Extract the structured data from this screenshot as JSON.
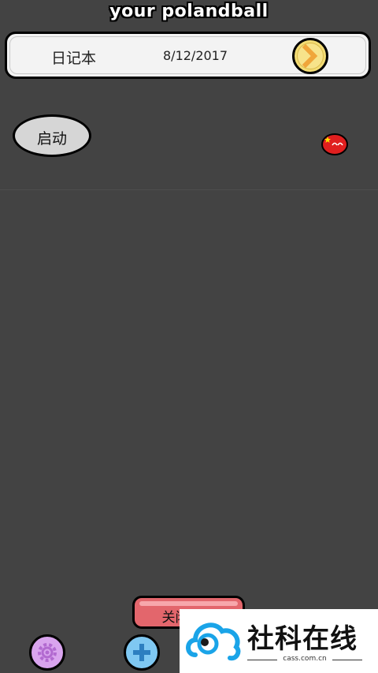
{
  "app": {
    "title": "your polandball"
  },
  "header": {
    "diary_label": "日记本",
    "date": "8/12/2017"
  },
  "main": {
    "start_label": "启动"
  },
  "footer": {
    "close_label": "关闭球球"
  },
  "watermark": {
    "brand": "社科在线",
    "domain": "cass.com.cn"
  },
  "colors": {
    "background": "#434343",
    "header_bar": "#f3f3f3",
    "next_button": "#f3dc74",
    "start_button": "#d6d6d6",
    "close_button": "#e3666c",
    "settings_button": "#d9a4ee",
    "add_button": "#7fc8f2",
    "ball": "#e01f1f"
  },
  "icons": {
    "next": "chevron-right-icon",
    "settings": "gear-icon",
    "add": "plus-icon",
    "ball": "china-ball-icon",
    "watermark": "eye-cloud-logo"
  }
}
